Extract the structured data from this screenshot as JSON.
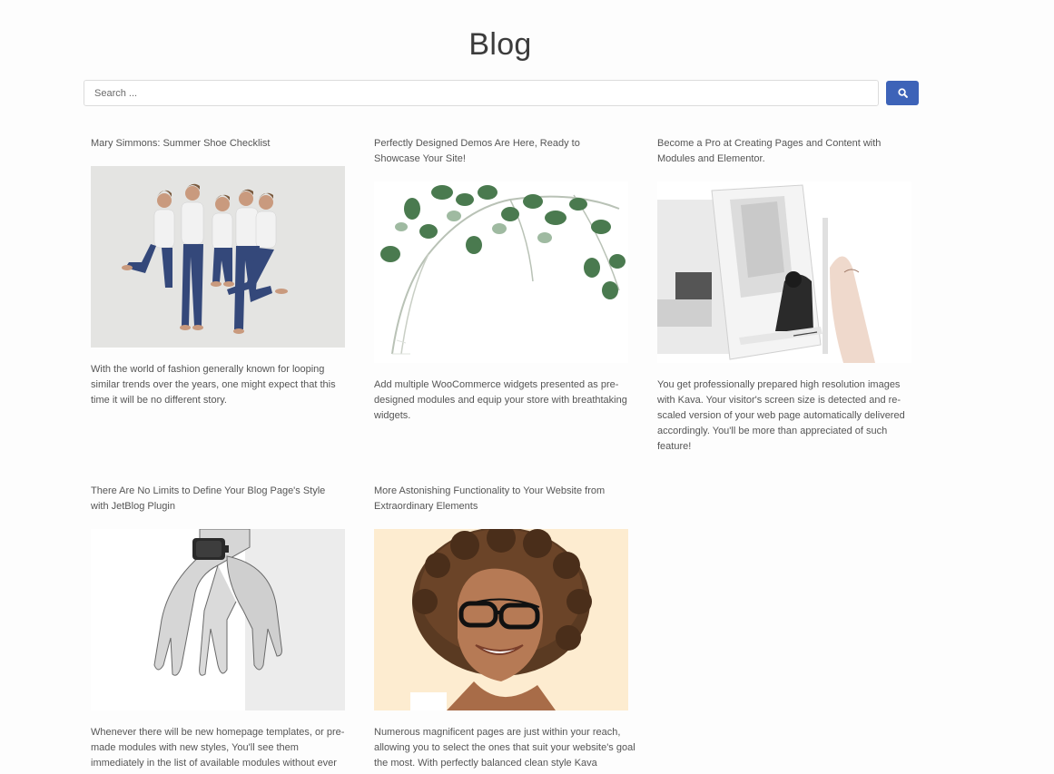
{
  "page": {
    "title": "Blog"
  },
  "search": {
    "placeholder": "Search ..."
  },
  "posts": [
    {
      "title": "Mary Simmons: Summer Shoe Checklist",
      "excerpt": "With the world of fashion generally known for looping similar trends over the years, one might expect that this time it will be no different story."
    },
    {
      "title": "Perfectly Designed Demos Are Here, Ready to Showcase Your Site!",
      "excerpt": "Add multiple WooCommerce widgets presented as pre-designed modules and equip your store with breathtaking widgets."
    },
    {
      "title": "Become a Pro at Creating Pages and Content with Modules and Elementor.",
      "excerpt": "You get professionally prepared high resolution images with Kava. Your visitor's screen size is detected and re-scaled version of your web page automatically delivered accordingly. You'll be more than appreciated of such feature!"
    },
    {
      "title": "There Are No Limits to Define Your Blog Page's Style with JetBlog Plugin",
      "excerpt": "Whenever there will be new homepage templates, or pre-made modules with new styles, You'll see them immediately in the list of available modules without ever"
    },
    {
      "title": "More Astonishing Functionality to Your Website from Extraordinary Elements",
      "excerpt": "Numerous magnificent pages are just within your reach, allowing you to select the ones that suit your website's goal the most. With perfectly balanced clean style Kava"
    }
  ],
  "colors": {
    "accent": "#3d63b8",
    "background": "#fdfdfd",
    "text": "#555555"
  },
  "icons": {
    "search_button": "search-icon"
  }
}
